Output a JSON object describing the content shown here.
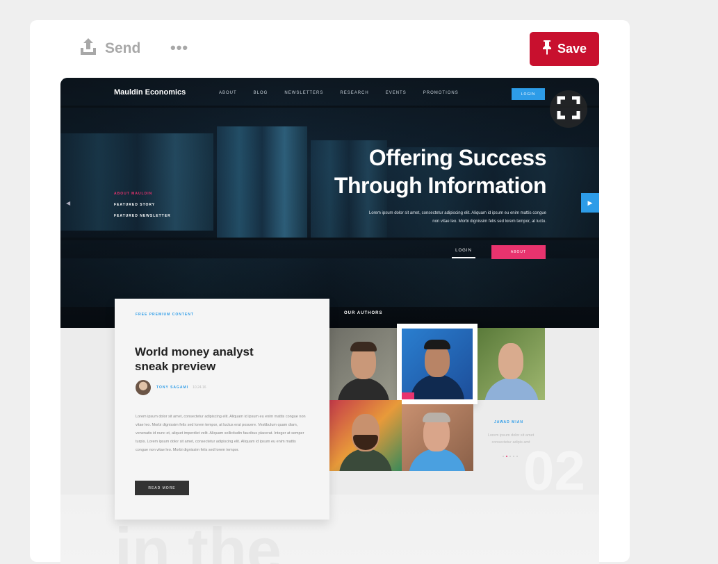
{
  "toolbar": {
    "send_label": "Send",
    "more_label": "•••",
    "save_label": "Save"
  },
  "icons": {
    "send": "share-upload-icon",
    "save": "pin-icon",
    "expand": "expand-icon"
  },
  "colors": {
    "save_red": "#c8102e",
    "accent_blue": "#2d9ce8",
    "accent_pink": "#e8336e"
  },
  "pin": {
    "site_logo": "Mauldin Economics",
    "nav": [
      "ABOUT",
      "BLOG",
      "NEWSLETTERS",
      "RESEARCH",
      "EVENTS",
      "PROMOTIONS"
    ],
    "nav_login": "LOGIN",
    "headline_line1": "Offering Success",
    "headline_line2": "Through Information",
    "hero_subtext": "Lorem ipsum dolor sit amet, consectetur adipiscing elit. Aliquam id ipsum eu enim mattis congue non vitae leo. Morbi dignissim felis sed lorem tempor, at luctu.",
    "side_links": [
      "ABOUT MAULDIN",
      "FEATURED STORY",
      "FEATURED NEWSLETTER"
    ],
    "hero_login": "LOGIN",
    "hero_about": "ABOUT",
    "premium_label": "FREE PREMIUM CONTENT",
    "card_title": "World money analyst sneak preview",
    "author_name": "TONY SAGAMI",
    "author_date": "10.24.16",
    "body_text": "Lorem ipsum dolor sit amet, consectetur adipiscing elit. Aliquam id ipsum eu enim mattis congue non vitae leo. Morbi dignissim felis sed lorem tempor, at luctus erat posuere. Vestibulum quam diam, venenatis id nunc et, aliquet imperdiet velit. Aliquam sollicitudin faucibus placerat. Integer at semper turpis. Lorem ipsum dolor sit amet, consectetur adipiscing elit. Aliquam id ipsum eu enim mattis congue non vitae leo. Morbi dignissim felis sed lorem tempor.",
    "read_more": "READ MORE",
    "our_authors": "OUR AUTHORS",
    "featured_author": "JAWAD MIAN",
    "featured_author_text": "Lorem ipsum dolor sit amet consectetur adipis amt",
    "big_number": "02",
    "ghost_text": "in the"
  }
}
